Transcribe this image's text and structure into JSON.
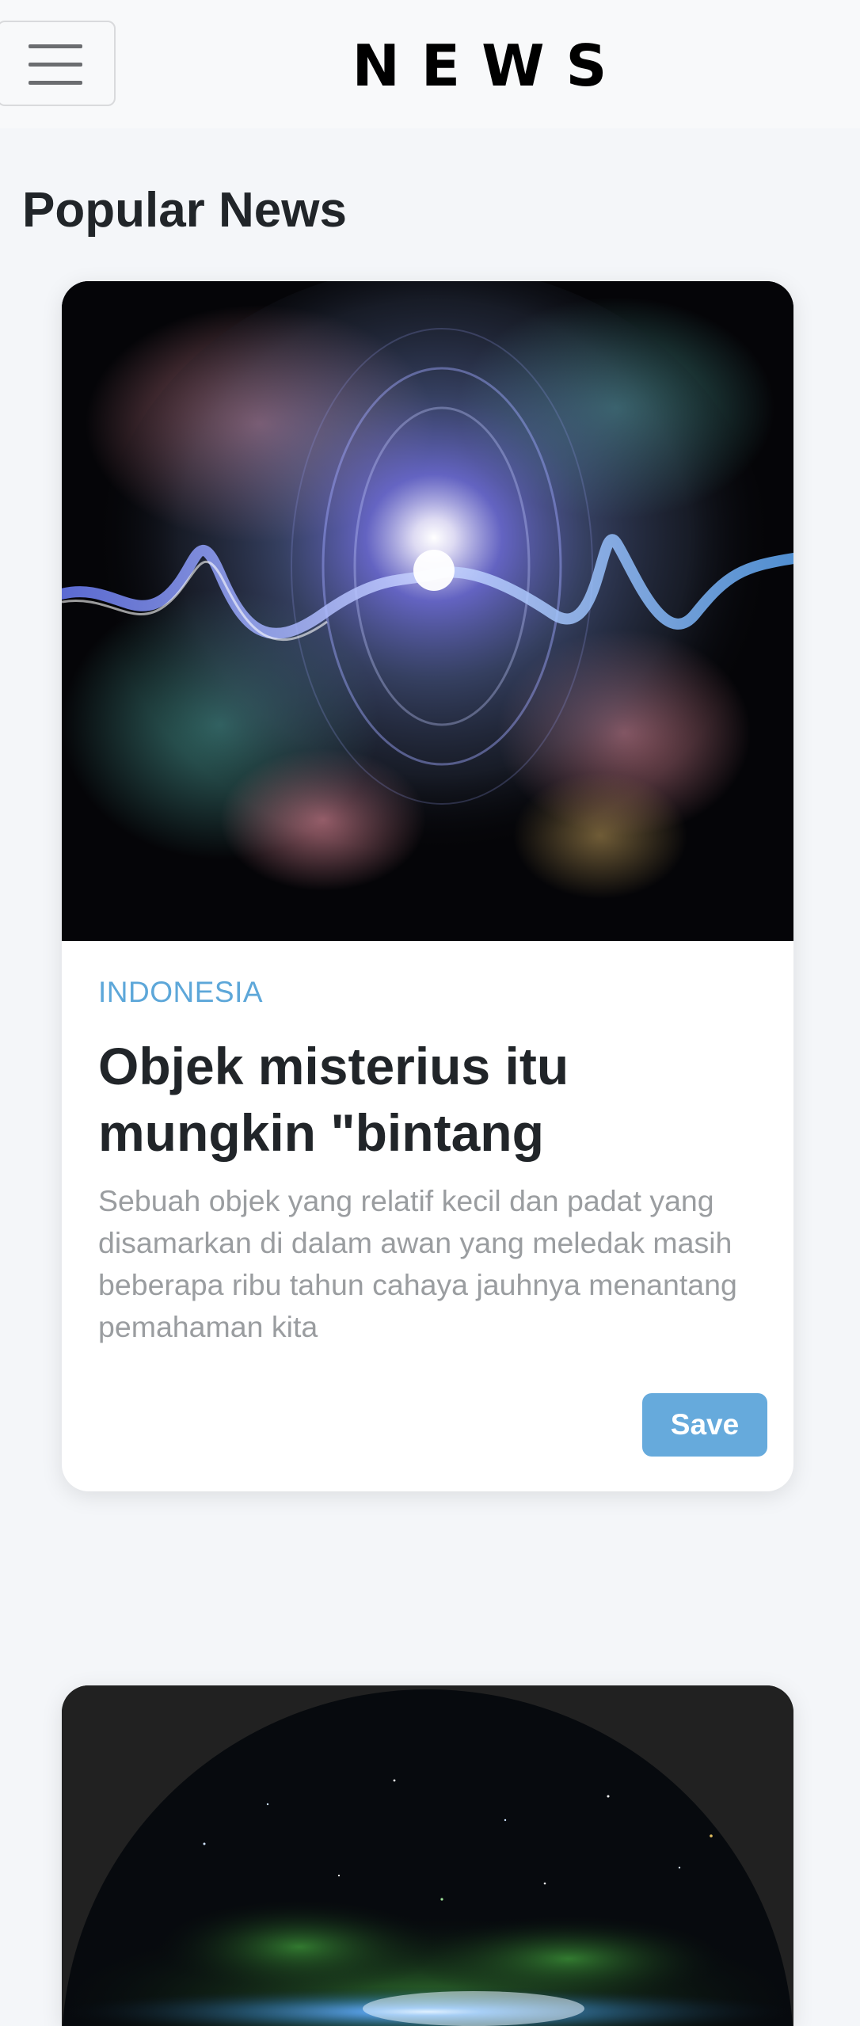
{
  "navbar": {
    "brand": "NEWS",
    "menu_icon": "hamburger-menu-icon"
  },
  "section": {
    "title": "Popular News"
  },
  "articles": [
    {
      "image": "abstract-energy-burst-image",
      "category": "INDONESIA",
      "headline": "Objek misterius itu mungkin \"bintang",
      "summary": "Sebuah objek yang relatif kecil dan padat yang disamarkan di dalam awan yang meledak masih beberapa ribu tahun cahaya jauhnya menantang pemahaman kita",
      "save_label": "Save"
    },
    {
      "image": "milky-way-night-sky-image"
    }
  ],
  "colors": {
    "accent": "#66aadc",
    "category": "#5da7d9",
    "summary": "#9a9da0",
    "page_background": "#f4f6f9"
  }
}
